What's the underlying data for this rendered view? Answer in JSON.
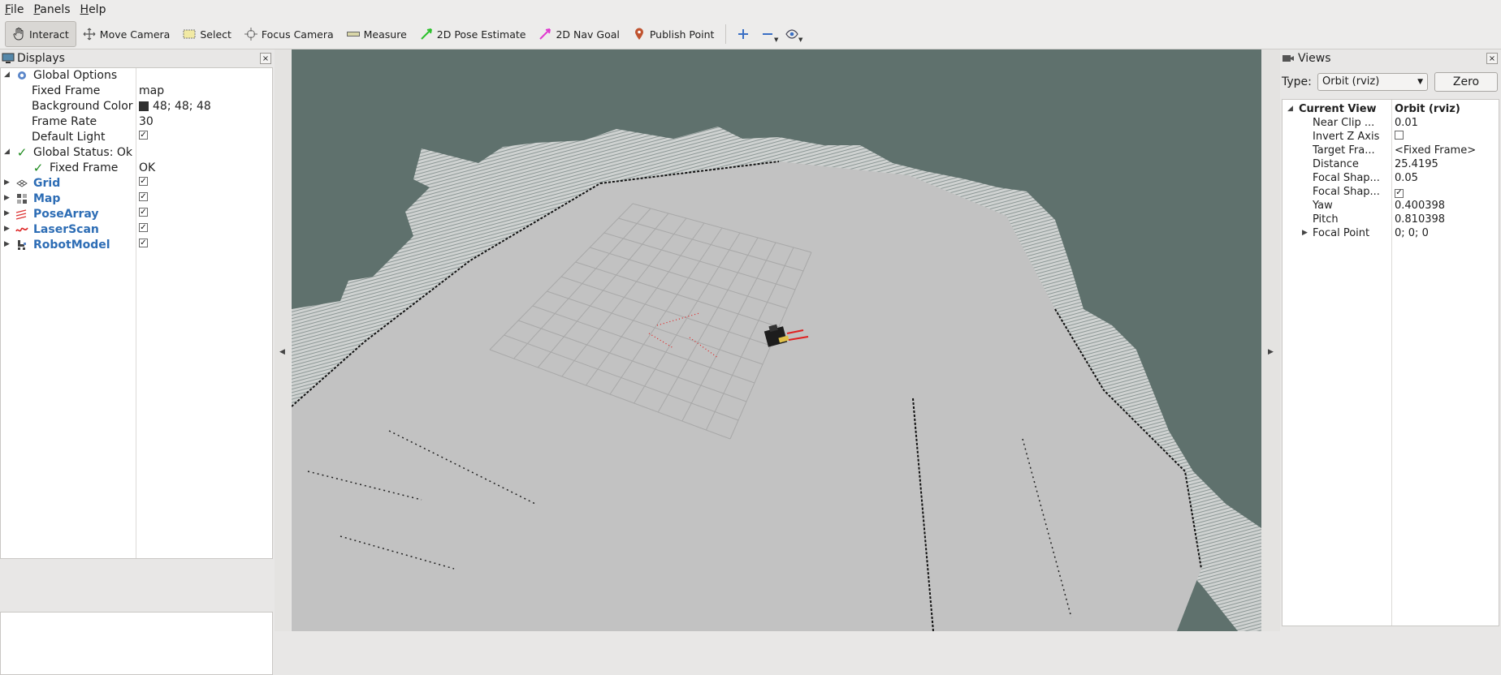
{
  "menubar": {
    "items": [
      {
        "u": "F",
        "rest": "ile"
      },
      {
        "u": "P",
        "rest": "anels"
      },
      {
        "u": "H",
        "rest": "elp"
      }
    ]
  },
  "toolbar": {
    "tools": [
      {
        "label": "Interact",
        "icon": "hand-icon",
        "active": true
      },
      {
        "label": "Move Camera",
        "icon": "move-arrows-icon"
      },
      {
        "label": "Select",
        "icon": "select-rect-icon"
      },
      {
        "label": "Focus Camera",
        "icon": "crosshair-icon"
      },
      {
        "label": "Measure",
        "icon": "ruler-icon"
      },
      {
        "label": "2D Pose Estimate",
        "icon": "green-arrow-icon"
      },
      {
        "label": "2D Nav Goal",
        "icon": "pink-arrow-icon"
      },
      {
        "label": "Publish Point",
        "icon": "map-pin-icon"
      }
    ],
    "icon_buttons": [
      "plus-icon",
      "minus-icon",
      "eye-icon"
    ]
  },
  "displays": {
    "title": "Displays",
    "close": "×",
    "rows": {
      "global_options": {
        "label": "Global Options"
      },
      "fixed_frame": {
        "label": "Fixed Frame",
        "value": "map"
      },
      "background_color": {
        "label": "Background Color",
        "value": "48; 48; 48",
        "color": "#303030"
      },
      "frame_rate": {
        "label": "Frame Rate",
        "value": "30"
      },
      "default_light": {
        "label": "Default Light",
        "checked": true
      },
      "global_status": {
        "label": "Global Status: Ok"
      },
      "status_fixed_frame": {
        "label": "Fixed Frame",
        "value": "OK"
      },
      "grid": {
        "label": "Grid",
        "checked": true
      },
      "map": {
        "label": "Map",
        "checked": true
      },
      "pose_array": {
        "label": "PoseArray",
        "checked": true
      },
      "laser_scan": {
        "label": "LaserScan",
        "checked": true
      },
      "robot_model": {
        "label": "RobotModel",
        "checked": true
      }
    }
  },
  "views": {
    "title": "Views",
    "close": "×",
    "type_label": "Type:",
    "type_value": "Orbit (rviz)",
    "zero_label": "Zero",
    "current_view": {
      "label": "Current View",
      "value": "Orbit (rviz)"
    },
    "props": {
      "near_clip": {
        "label": "Near Clip ...",
        "value": "0.01"
      },
      "invert_z": {
        "label": "Invert Z Axis",
        "checked": false
      },
      "target_frame": {
        "label": "Target Fra...",
        "value": "<Fixed Frame>"
      },
      "distance": {
        "label": "Distance",
        "value": "25.4195"
      },
      "focal_shape_size": {
        "label": "Focal Shap...",
        "value": "0.05"
      },
      "focal_shape_fixed": {
        "label": "Focal Shap...",
        "checked": true
      },
      "yaw": {
        "label": "Yaw",
        "value": "0.400398"
      },
      "pitch": {
        "label": "Pitch",
        "value": "0.810398"
      },
      "focal_point": {
        "label": "Focal Point",
        "value": "0; 0; 0"
      }
    }
  },
  "colors": {
    "viewport_bg": "#5f716d",
    "map_floor": "#c2c2c2",
    "link_blue": "#2d6db5",
    "laser_red": "#e02020"
  }
}
